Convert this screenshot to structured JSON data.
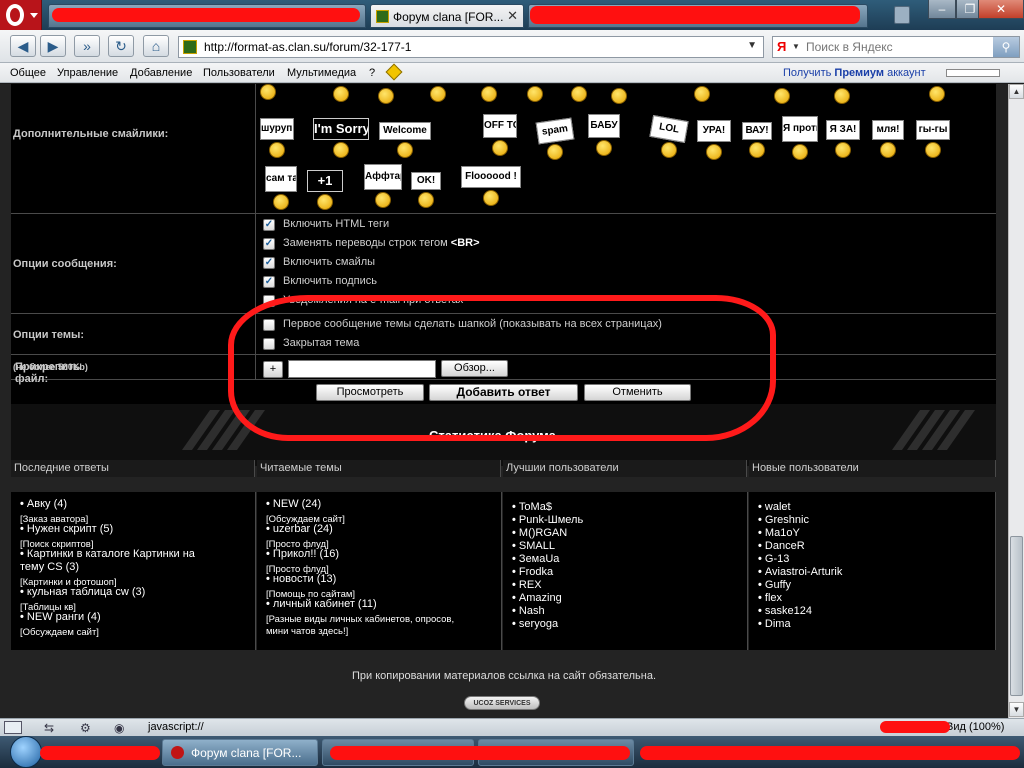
{
  "browser": {
    "active_tab_title": "Форум clana [FOR...",
    "url": "http://format-as.clan.su/forum/32-177-1",
    "search_placeholder": "Поиск в Яндекс",
    "search_engine_letter": "Я"
  },
  "menu": {
    "items": [
      "Общее",
      "Управление",
      "Добавление",
      "Пользователи",
      "Мультимедиа",
      "?"
    ],
    "premium_prefix": "Получить ",
    "premium_bold": "Премиум",
    "premium_suffix": " аккаунт"
  },
  "form": {
    "extra_smilies_label": "Дополнительные смайлики:",
    "smiley_signs": [
      "шуруп!",
      "I'm Sorry!",
      "Welcome",
      "OFF TOPIC!",
      "spam",
      "БАБУ",
      "LOL",
      "УРА!",
      "ВАУ!",
      "Я против",
      "Я ЗА!",
      "мля!",
      "гы-гы",
      "сам такой",
      "+1",
      "Аффтар ЖЖОТ!",
      "OK!",
      "Floooood !"
    ],
    "message_options_label": "Опции сообщения:",
    "message_options": [
      {
        "pre": "Включить HTML теги",
        "bold": "",
        "checked": true
      },
      {
        "pre": "Заменять переводы строк тегом ",
        "bold": "<BR>",
        "checked": true
      },
      {
        "pre": "Включить смайлы",
        "bold": "",
        "checked": true
      },
      {
        "pre": "Включить подпись",
        "bold": "",
        "checked": true
      },
      {
        "pre": "Уведомления на e-mail при ответах",
        "bold": "",
        "checked": false
      }
    ],
    "topic_options_label": "Опции темы:",
    "topic_options": [
      {
        "text": "Первое сообщение темы сделать шапкой (показывать на всех страницах)",
        "checked": false
      },
      {
        "text": "Закрытая тема",
        "checked": false
      }
    ],
    "attach_label": "Прикрепить файл:",
    "attach_note": "(не более 500Kb)",
    "plus_label": "+",
    "browse_label": "Обзор...",
    "preview_label": "Просмотреть",
    "submit_label": "Добавить ответ",
    "cancel_label": "Отменить"
  },
  "stats": {
    "title": "Статистика Форума",
    "columns": [
      {
        "header": "Последние ответы",
        "entries": [
          {
            "title": "Авку (4)",
            "category": "[Заказ аватора]"
          },
          {
            "title": "Нужен скрипт (5)",
            "category": "[Поиск скриптов]"
          },
          {
            "title": "Картинки в каталоге Картинки на",
            "title2": "тему CS (3)",
            "category": "[Картинки и фотошоп]"
          },
          {
            "title": "кульная таблица cw (3)",
            "category": "[Таблицы кв]"
          },
          {
            "title": "NEW ранги (4)",
            "category": "[Обсуждаем сайт]"
          }
        ]
      },
      {
        "header": "Читаемые темы",
        "entries": [
          {
            "title": "NEW (24)",
            "category": "[Обсуждаем сайт]"
          },
          {
            "title": "uzerbar (24)",
            "category": "[Просто флуд]"
          },
          {
            "title": "Прикол!! (16)",
            "category": "[Просто флуд]"
          },
          {
            "title": "новости (13)",
            "category": "[Помощь по сайтам]"
          },
          {
            "title": "личный кабинет (11)",
            "category": "[Разные виды личных кабинетов, опросов,",
            "category2": "мини чатов здесь!]"
          }
        ]
      },
      {
        "header": "Лучшии пользователи",
        "users": [
          "ToMa$",
          "Punk-Шмель",
          "M()RGAN",
          "SMALL",
          "ЗемаUa",
          "Frodka",
          "REX",
          "Amazing",
          "Nash",
          "seryoga"
        ]
      },
      {
        "header": "Новые пользователи",
        "users": [
          "walet",
          "Greshnic",
          "Ma1oY",
          "DanceR",
          "G-13",
          "Aviastroi-Arturik",
          "Guffy",
          "flex",
          "saske124",
          "Dima"
        ]
      }
    ]
  },
  "footer": {
    "copy_notice": "При копировании материалов ссылка на сайт обязательна.",
    "ucoz_label": "UCOZ SERVICES"
  },
  "statusbar": {
    "javascript_text": "javascript://",
    "zoom_text": "Вид (100%)"
  },
  "taskbar": {
    "opera_task_label": "Форум clana [FOR..."
  },
  "colors": {
    "annotation_red": "#ff1a1a",
    "page_background": "#000000"
  }
}
